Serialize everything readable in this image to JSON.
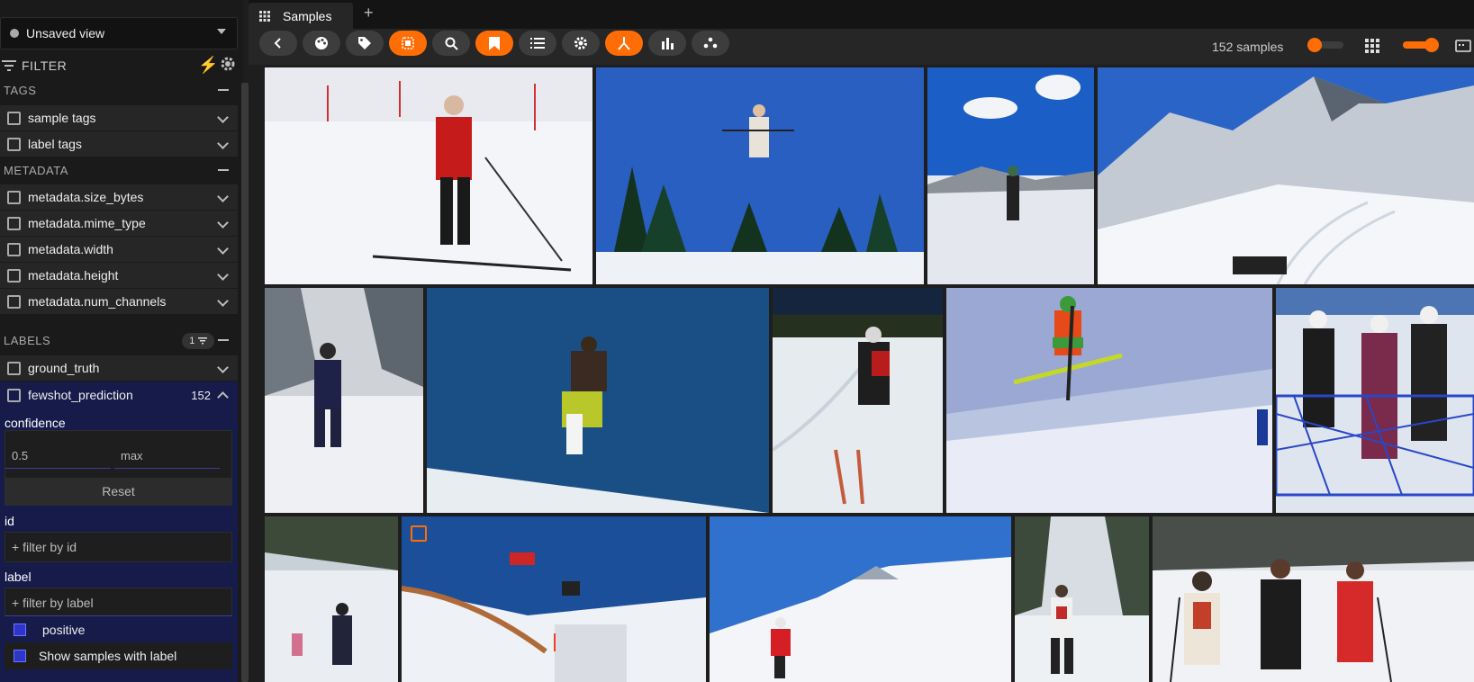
{
  "sidebar": {
    "view_label": "Unsaved view",
    "filter_label": "FILTER",
    "sections": {
      "tags": "TAGS",
      "metadata": "METADATA",
      "labels": "LABELS",
      "labels_badge": "1"
    },
    "tag_fields": [
      "sample tags",
      "label tags"
    ],
    "metadata_fields": [
      "metadata.size_bytes",
      "metadata.mime_type",
      "metadata.width",
      "metadata.height",
      "metadata.num_channels"
    ],
    "label_fields": [
      "ground_truth"
    ],
    "expanded_field": {
      "name": "fewshot_prediction",
      "count": "152",
      "confidence_label": "confidence",
      "min_value": "0.5",
      "max_placeholder": "max",
      "reset_label": "Reset",
      "id_label": "id",
      "id_placeholder": "+ filter by id",
      "label_label": "label",
      "label_placeholder": "+ filter by label",
      "label_option": "positive",
      "show_samples": "Show samples with label"
    }
  },
  "tabs": {
    "samples": "Samples",
    "add": "+"
  },
  "toolbar": {
    "buttons": [
      {
        "icon": "back-icon",
        "active": false
      },
      {
        "icon": "palette-icon",
        "active": false
      },
      {
        "icon": "tag-icon",
        "active": false
      },
      {
        "icon": "patches-icon",
        "active": true
      },
      {
        "icon": "search-icon",
        "active": false
      },
      {
        "icon": "bookmark-icon",
        "active": true
      },
      {
        "icon": "list-icon",
        "active": false
      },
      {
        "icon": "gear-icon",
        "active": false
      },
      {
        "icon": "merge-icon",
        "active": true
      },
      {
        "icon": "bar-chart-icon",
        "active": false
      },
      {
        "icon": "embeddings-icon",
        "active": false
      }
    ],
    "samples_count": "152 samples"
  },
  "colors": {
    "accent": "#ff6d04",
    "expanded_bg": "#161b4a"
  }
}
